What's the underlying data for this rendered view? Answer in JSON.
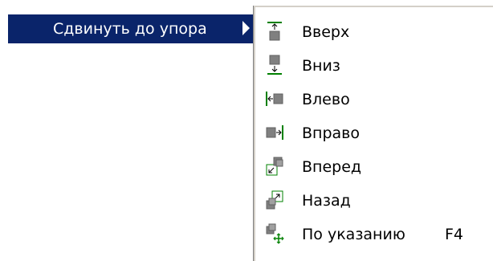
{
  "parent_menu": {
    "item_label": "Сдвинуть до упора"
  },
  "submenu": {
    "items": [
      {
        "label": "Вверх",
        "icon": "move-to-top-icon",
        "shortcut": ""
      },
      {
        "label": "Вниз",
        "icon": "move-to-bottom-icon",
        "shortcut": ""
      },
      {
        "label": "Влево",
        "icon": "move-to-left-icon",
        "shortcut": ""
      },
      {
        "label": "Вправо",
        "icon": "move-to-right-icon",
        "shortcut": ""
      },
      {
        "label": "Вперед",
        "icon": "bring-to-front-icon",
        "shortcut": ""
      },
      {
        "label": "Назад",
        "icon": "send-to-back-icon",
        "shortcut": ""
      },
      {
        "label": "По указанию",
        "icon": "move-by-pointer-icon",
        "shortcut": "F4"
      }
    ]
  },
  "colors": {
    "highlight": "#0a246a",
    "icon_fill": "#808080",
    "icon_accent": "#008000"
  }
}
